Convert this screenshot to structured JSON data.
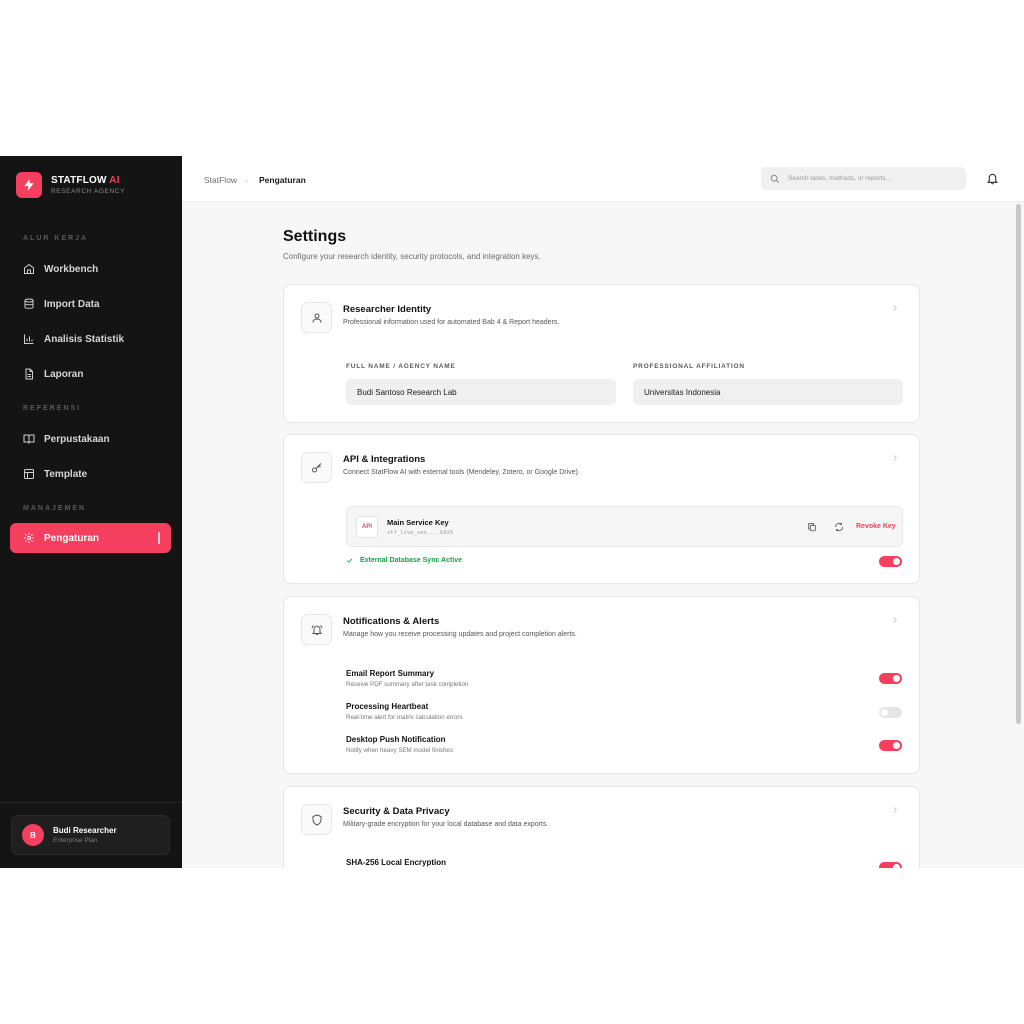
{
  "brand": {
    "name_main": "STATFLOW",
    "name_accent": "AI",
    "subtitle": "RESEARCH AGENCY"
  },
  "sidebar": {
    "sections": [
      {
        "label": "ALUR KERJA"
      },
      {
        "label": "REFERENSI"
      },
      {
        "label": "MANAJEMEN"
      }
    ],
    "items": [
      {
        "label": "Workbench",
        "icon": "home-icon"
      },
      {
        "label": "Import Data",
        "icon": "database-icon"
      },
      {
        "label": "Analisis Statistik",
        "icon": "bar-chart-icon"
      },
      {
        "label": "Laporan",
        "icon": "file-text-icon"
      },
      {
        "label": "Perpustakaan",
        "icon": "book-open-icon"
      },
      {
        "label": "Template",
        "icon": "layout-icon"
      },
      {
        "label": "Pengaturan",
        "icon": "gear-icon",
        "active": true
      }
    ],
    "user": {
      "initial": "B",
      "name": "Budi Researcher",
      "plan": "Enterprise Plan"
    }
  },
  "header": {
    "breadcrumb_root": "StatFlow",
    "breadcrumb_current": "Pengaturan",
    "search_placeholder": "Search tasks, methods, or reports..."
  },
  "page": {
    "title": "Settings",
    "subtitle": "Configure your research identity, security protocols, and integration keys."
  },
  "identity": {
    "title": "Researcher Identity",
    "description": "Professional information used for automated Bab 4 & Report headers.",
    "full_name_label": "FULL NAME / AGENCY NAME",
    "full_name_value": "Budi Santoso Research Lab",
    "affiliation_label": "PROFESSIONAL AFFILIATION",
    "affiliation_value": "Universitas Indonesia"
  },
  "api": {
    "title": "API & Integrations",
    "description": "Connect StatFlow AI with external tools (Mendeley, Zotero, or Google Drive).",
    "key_badge": "API",
    "key_name": "Main Service Key",
    "key_value": "stf_live_seo....k9z5",
    "revoke_label": "Revoke Key",
    "sync_status": "External Database Sync Active",
    "sync_enabled": true
  },
  "notifications": {
    "title": "Notifications & Alerts",
    "description": "Manage how you receive processing updates and project completion alerts.",
    "items": [
      {
        "title": "Email Report Summary",
        "description": "Receive PDF summary after task completion",
        "enabled": true
      },
      {
        "title": "Processing Heartbeat",
        "description": "Real-time alert for matrix calculation errors",
        "enabled": false
      },
      {
        "title": "Desktop Push Notification",
        "description": "Notify when heavy SEM model finishes",
        "enabled": true
      }
    ]
  },
  "security": {
    "title": "Security & Data Privacy",
    "description": "Military-grade encryption for your local database and data exports.",
    "items": [
      {
        "title": "SHA-256 Local Encryption",
        "enabled": true
      }
    ]
  },
  "colors": {
    "accent": "#f43f5e",
    "sidebar_bg": "#141414",
    "success": "#16a34a"
  }
}
